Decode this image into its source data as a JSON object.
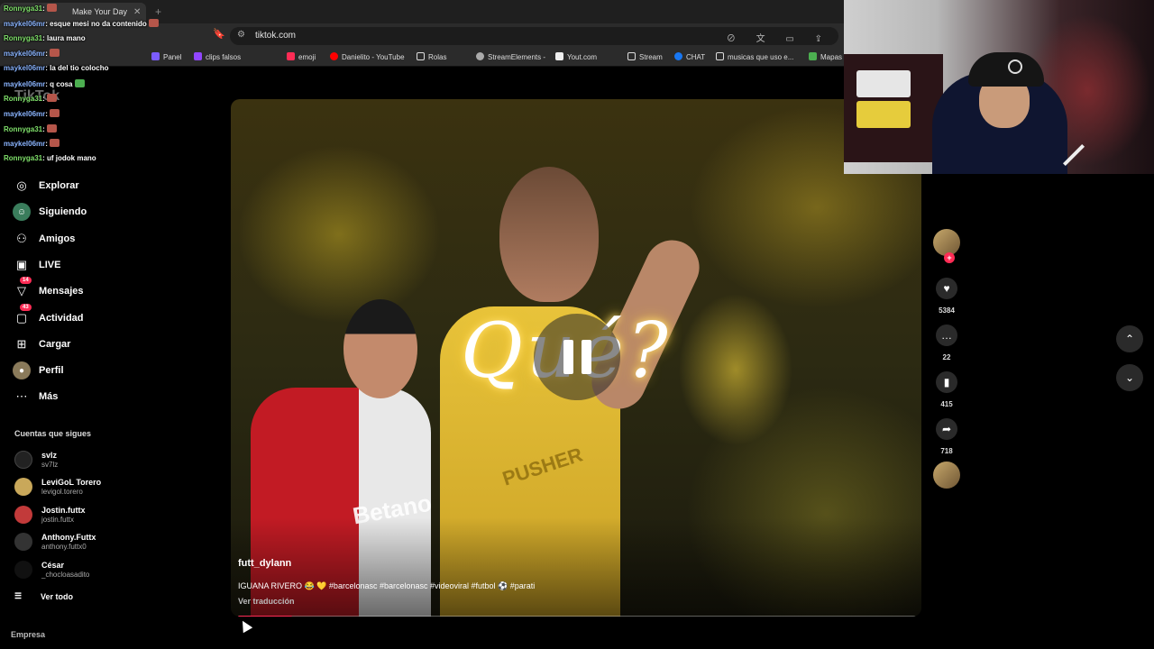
{
  "browser": {
    "tab_title": "Make Your Day",
    "url": "tiktok.com",
    "bookmarks": [
      "Panel",
      "clips falsos",
      "emoji",
      "Danielito - YouTube",
      "Rolas",
      "StreamElements -",
      "Yout.com",
      "Stream",
      "CHAT",
      "musicas que uso e...",
      "Mapas"
    ]
  },
  "chat": [
    {
      "user": "Ronnyga31",
      "msg": ":"
    },
    {
      "user": "maykel06mr",
      "msg": ": esque mesi no da contenido"
    },
    {
      "user": "Ronnyga31",
      "msg": ": laura mano"
    },
    {
      "user": "maykel06mr",
      "msg": ":"
    },
    {
      "user": "maykel06mr",
      "msg": ": la del tio colocho"
    },
    {
      "user": "maykel06mr",
      "msg": ": q cosa"
    },
    {
      "user": "Ronnyga31",
      "msg": ":"
    },
    {
      "user": "maykel06mr",
      "msg": ":"
    },
    {
      "user": "Ronnyga31",
      "msg": ":"
    },
    {
      "user": "maykel06mr",
      "msg": ":"
    },
    {
      "user": "Ronnyga31",
      "msg": ": uf jodok mano"
    }
  ],
  "logo": "TikTok",
  "nav": [
    {
      "label": "Explorar",
      "icon": "compass-icon"
    },
    {
      "label": "Siguiendo",
      "icon": "following-icon"
    },
    {
      "label": "Amigos",
      "icon": "friends-icon"
    },
    {
      "label": "LIVE",
      "icon": "live-icon"
    },
    {
      "label": "Mensajes",
      "icon": "messages-icon",
      "badge": "14"
    },
    {
      "label": "Actividad",
      "icon": "activity-icon",
      "badge": "43"
    },
    {
      "label": "Cargar",
      "icon": "upload-icon"
    },
    {
      "label": "Perfil",
      "icon": "profile-icon"
    },
    {
      "label": "Más",
      "icon": "more-icon"
    }
  ],
  "following": {
    "heading": "Cuentas que sigues",
    "accounts": [
      {
        "name": "svlz",
        "handle": "sv7lz",
        "color": "#222222"
      },
      {
        "name": "LeviGoL Torero",
        "handle": "levigol.torero",
        "color": "#c9a85a"
      },
      {
        "name": "Jostin.futtx",
        "handle": "jostin.futtx",
        "color": "#c23a3a"
      },
      {
        "name": "Anthony.Futtx",
        "handle": "anthony.futtx0",
        "color": "#333333"
      },
      {
        "name": "César",
        "handle": "_chocloasadito",
        "color": "#111111"
      }
    ],
    "see_all": "Ver todo"
  },
  "footer": {
    "empresa": "Empresa"
  },
  "video": {
    "author": "futt_dylann",
    "caption": "IGUANA RIVERO 😂 💛 #barcelonasc #barcelonasc #videoviral #futbol ⚽ #parati",
    "translate": "Ver traducción",
    "overlay_text": "Qué?",
    "sponsor": "Betano",
    "jersey_text": "PUSHER",
    "progress": 0.08
  },
  "actions": {
    "likes": "5384",
    "comments": "22",
    "saves": "415",
    "shares": "718"
  },
  "colors": {
    "accent": "#fe2c55",
    "background": "#000000"
  }
}
